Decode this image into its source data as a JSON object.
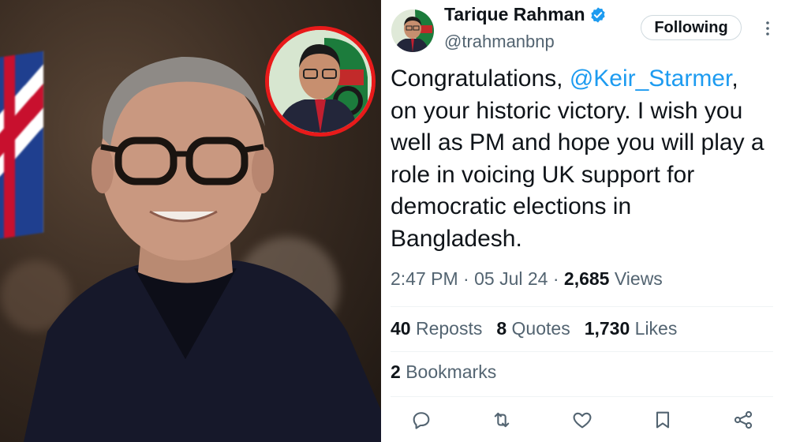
{
  "tweet": {
    "author_name": "Tarique Rahman",
    "handle": "@trahmanbnp",
    "follow_label": "Following",
    "text_before": "Congratulations, ",
    "mention": "@Keir_Starmer",
    "text_after": ", on your historic victory. I wish you well as PM and hope you will play a role in voicing UK support for democratic elections in Bangladesh.",
    "time": "2:47 PM",
    "date": "05 Jul 24",
    "views_count": "2,685",
    "views_label": "Views",
    "reposts_count": "40",
    "reposts_label": "Reposts",
    "quotes_count": "8",
    "quotes_label": "Quotes",
    "likes_count": "1,730",
    "likes_label": "Likes",
    "bookmarks_count": "2",
    "bookmarks_label": "Bookmarks"
  },
  "icons": {
    "verified": "verified-badge-icon",
    "more": "more-vertical-icon",
    "reply": "reply-icon",
    "repost": "repost-icon",
    "like": "heart-icon",
    "bookmark": "bookmark-icon",
    "share": "share-icon"
  },
  "colors": {
    "accent": "#1d9bf0",
    "text": "#0f1419",
    "secondary": "#536471",
    "inset_border": "#e81a1a"
  }
}
